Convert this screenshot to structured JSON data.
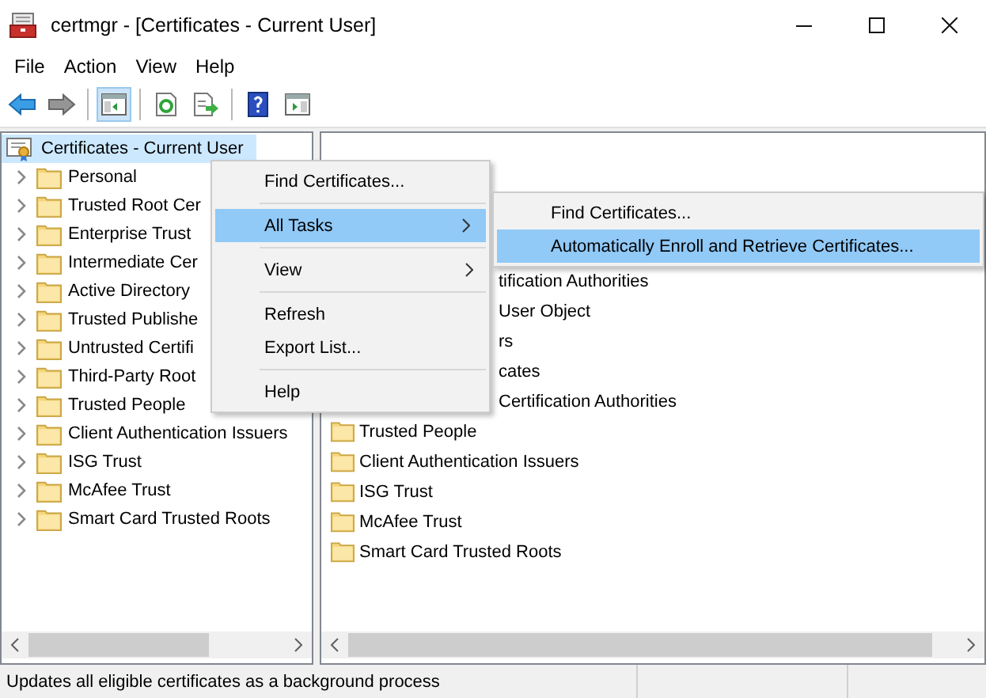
{
  "window": {
    "title": "certmgr - [Certificates - Current User]"
  },
  "menu_bar": [
    "File",
    "Action",
    "View",
    "Help"
  ],
  "toolbar": [
    {
      "kind": "back",
      "disabled": false,
      "pressed": false
    },
    {
      "kind": "forward",
      "disabled": true,
      "pressed": false
    },
    {
      "kind": "tree-toggle",
      "disabled": false,
      "pressed": true
    },
    {
      "kind": "refresh",
      "disabled": false,
      "pressed": false
    },
    {
      "kind": "export",
      "disabled": false,
      "pressed": false
    },
    {
      "kind": "help",
      "disabled": false,
      "pressed": false
    },
    {
      "kind": "pane-toggle",
      "disabled": false,
      "pressed": false
    }
  ],
  "tree": {
    "root": {
      "label": "Certificates - Current User",
      "selected": true,
      "children": [
        {
          "label": "Personal",
          "expanded": false
        },
        {
          "label": "Trusted Root Cer",
          "expanded": false
        },
        {
          "label": "Enterprise Trust",
          "expanded": false
        },
        {
          "label": "Intermediate Cer",
          "expanded": false
        },
        {
          "label": "Active Directory",
          "expanded": false
        },
        {
          "label": "Trusted Publishe",
          "expanded": false
        },
        {
          "label": "Untrusted Certifi",
          "expanded": false
        },
        {
          "label": "Third-Party Root",
          "expanded": false
        },
        {
          "label": "Trusted People",
          "expanded": false
        },
        {
          "label": "Client Authentication Issuers",
          "expanded": false
        },
        {
          "label": "ISG Trust",
          "expanded": false
        },
        {
          "label": "McAfee Trust",
          "expanded": false
        },
        {
          "label": "Smart Card Trusted Roots",
          "expanded": false
        }
      ]
    }
  },
  "list": {
    "rows": [
      {
        "kind": "clipped",
        "label": "tification Authorities"
      },
      {
        "kind": "clipped",
        "label": "User Object"
      },
      {
        "kind": "clipped",
        "label": "rs"
      },
      {
        "kind": "clipped",
        "label": "cates"
      },
      {
        "kind": "clipped",
        "label": "Certification Authorities"
      },
      {
        "kind": "folder",
        "label": "Trusted People"
      },
      {
        "kind": "folder",
        "label": "Client Authentication Issuers"
      },
      {
        "kind": "folder",
        "label": "ISG Trust"
      },
      {
        "kind": "folder",
        "label": "McAfee Trust"
      },
      {
        "kind": "folder",
        "label": "Smart Card Trusted Roots"
      }
    ]
  },
  "context_menu": {
    "items": [
      {
        "kind": "item",
        "label": "Find Certificates...",
        "submenu": false,
        "selected": false
      },
      {
        "kind": "separator"
      },
      {
        "kind": "item",
        "label": "All Tasks",
        "submenu": true,
        "selected": true
      },
      {
        "kind": "separator"
      },
      {
        "kind": "item",
        "label": "View",
        "submenu": true,
        "selected": false
      },
      {
        "kind": "separator"
      },
      {
        "kind": "item",
        "label": "Refresh",
        "submenu": false,
        "selected": false
      },
      {
        "kind": "item",
        "label": "Export List...",
        "submenu": false,
        "selected": false
      },
      {
        "kind": "separator"
      },
      {
        "kind": "item",
        "label": "Help",
        "submenu": false,
        "selected": false
      }
    ]
  },
  "submenu": {
    "items": [
      {
        "label": "Find Certificates...",
        "selected": false
      },
      {
        "label": "Automatically Enroll and Retrieve Certificates...",
        "selected": true
      }
    ]
  },
  "status_bar": {
    "text": "Updates all eligible certificates as a background process"
  }
}
